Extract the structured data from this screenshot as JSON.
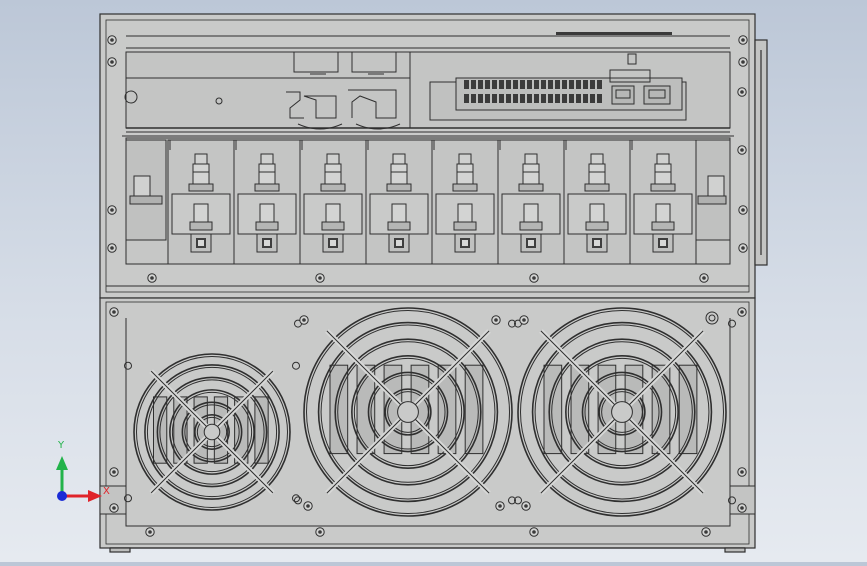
{
  "viewport": {
    "background_top": "#bcc7d7",
    "background_bottom": "#e6eaf0"
  },
  "model": {
    "subject": "inverter-drive-front-view",
    "line_color": "#2f2f2f",
    "body_color": "#c9cac9",
    "shade_color": "#b8b9b8",
    "terminal_count": 8,
    "fan_count": 3
  },
  "triad": {
    "y_label": "Y",
    "x_label": "X",
    "y_color": "#22b34a",
    "x_color": "#e0232a",
    "z_color": "#1a2bd6"
  }
}
